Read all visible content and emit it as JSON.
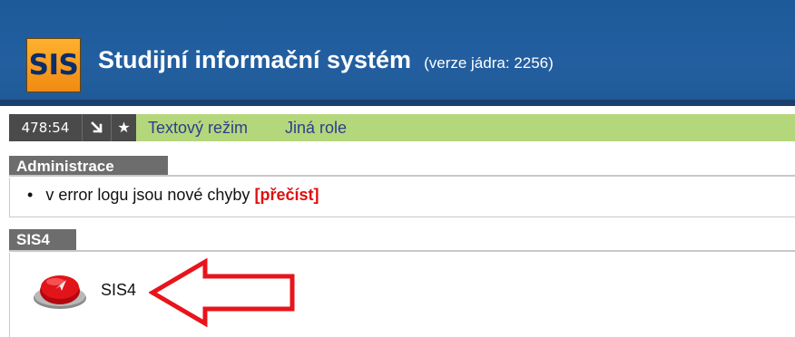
{
  "header": {
    "logo_text": "SIS",
    "title": "Studijní informační systém",
    "subtitle": "(verze jádra: 2256)"
  },
  "toolbar": {
    "clock": "478:54",
    "icons": [
      "arrow-down-right-icon",
      "star-icon"
    ],
    "links": [
      "Textový režim",
      "Jiná role"
    ]
  },
  "sections": {
    "admin": {
      "heading": "Administrace",
      "item_text": "v error logu jsou nové chyby",
      "action": "[přečíst]"
    },
    "sis4": {
      "heading": "SIS4",
      "app_label": "SIS4",
      "app_icon": "red-button-icon"
    }
  },
  "annotation": {
    "type": "arrow-pointing-left",
    "color": "#e8141c"
  },
  "colors": {
    "header_bg": "#235fa0",
    "toolbar_bg": "#b5d77c",
    "section_heading_bg": "#6d6d6d",
    "action_red": "#e01010",
    "logo_orange": "#f8a222"
  }
}
